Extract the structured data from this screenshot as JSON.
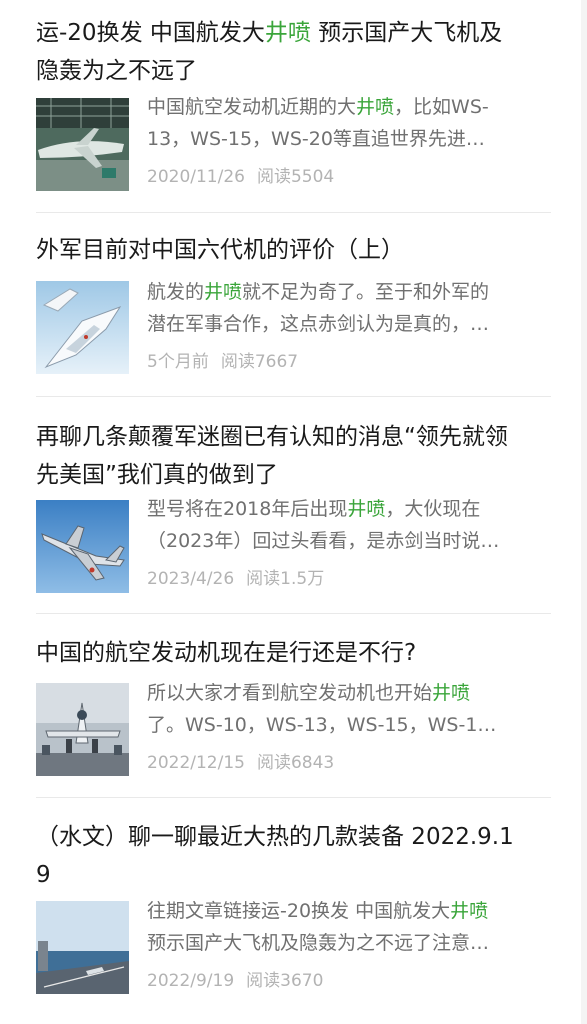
{
  "highlight_color": "#3aa53a",
  "articles": [
    {
      "title_lines": [
        [
          {
            "t": "运-20换发 中国航发大"
          },
          {
            "t": "井喷",
            "hl": true
          },
          {
            "t": " 预示国产大飞机及"
          }
        ],
        [
          {
            "t": "隐轰为之不远了"
          }
        ]
      ],
      "snippet_lines": [
        [
          {
            "t": "中国航空发动机近期的大"
          },
          {
            "t": "井喷",
            "hl": true
          },
          {
            "t": "，比如WS-"
          }
        ],
        [
          {
            "t": "13，WS-15，WS-20等直追世界先进…"
          }
        ]
      ],
      "date": "2020/11/26",
      "reads": "阅读5504",
      "thumb_icon": "aircraft-hangar-thumbnail"
    },
    {
      "title_lines": [
        [
          {
            "t": "外军目前对中国六代机的评价（上）"
          }
        ]
      ],
      "snippet_lines": [
        [
          {
            "t": "航发的"
          },
          {
            "t": "井喷",
            "hl": true
          },
          {
            "t": "就不足为奇了。至于和外军的"
          }
        ],
        [
          {
            "t": "潜在军事合作，这点赤剑认为是真的，…"
          }
        ]
      ],
      "date": "5个月前",
      "reads": "阅读7667",
      "thumb_icon": "sixth-gen-fighter-thumbnail"
    },
    {
      "title_lines": [
        [
          {
            "t": "再聊几条颠覆军迷圈已有认知的消息“领先就领"
          }
        ],
        [
          {
            "t": "先美国”我们真的做到了"
          }
        ]
      ],
      "snippet_lines": [
        [
          {
            "t": "型号将在2018年后出现"
          },
          {
            "t": "井喷",
            "hl": true
          },
          {
            "t": "，大伙现在"
          }
        ],
        [
          {
            "t": "（2023年）回过头看看，是赤剑当时说…"
          }
        ]
      ],
      "date": "2023/4/26",
      "reads": "阅读1.5万",
      "thumb_icon": "fighter-jet-sky-thumbnail"
    },
    {
      "title_lines": [
        [
          {
            "t": "中国的航空发动机现在是行还是不行?"
          }
        ]
      ],
      "snippet_lines": [
        [
          {
            "t": "所以大家才看到航空发动机也开始"
          },
          {
            "t": "井喷",
            "hl": true
          }
        ],
        [
          {
            "t": "了。WS-10，WS-13，WS-15，WS-1…"
          }
        ]
      ],
      "date": "2022/12/15",
      "reads": "阅读6843",
      "thumb_icon": "jet-display-thumbnail"
    },
    {
      "title_lines": [
        [
          {
            "t": "（水文）聊一聊最近大热的几款装备 2022.9.1"
          }
        ],
        [
          {
            "t": "9"
          }
        ]
      ],
      "snippet_lines": [
        [
          {
            "t": "往期文章链接运-20换发 中国航发大"
          },
          {
            "t": "井喷",
            "hl": true
          }
        ],
        [
          {
            "t": "预示国产大飞机及隐轰为之不远了注意…"
          }
        ]
      ],
      "date": "2022/9/19",
      "reads": "阅读3670",
      "thumb_icon": "carrier-deck-thumbnail"
    }
  ]
}
